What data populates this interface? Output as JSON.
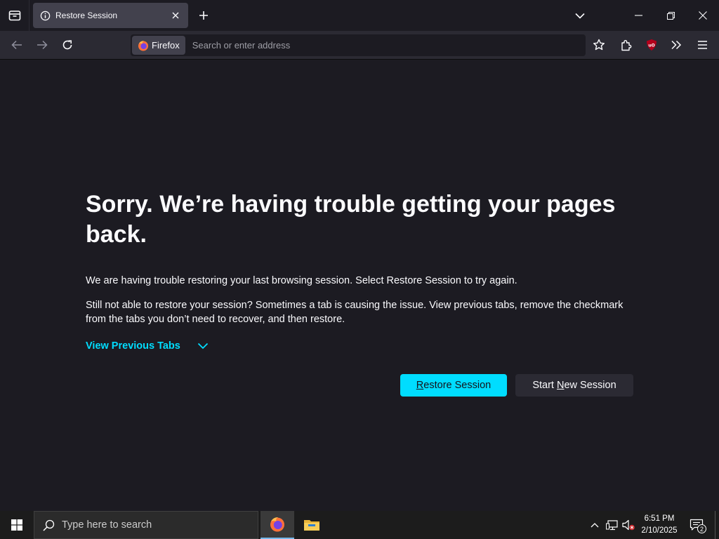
{
  "tab": {
    "title": "Restore Session",
    "icons": {
      "list": "tab-list-icon",
      "info": "info-icon",
      "close": "close-icon",
      "new": "plus-icon",
      "chevron": "chevron-down-icon"
    }
  },
  "window_controls": [
    "minimize-icon",
    "restore-icon",
    "close-icon"
  ],
  "navbar": {
    "identity_label": "Firefox",
    "url_placeholder": "Search or enter address",
    "icons": [
      "back-arrow-icon",
      "forward-arrow-icon",
      "reload-icon",
      "bookmark-star-icon",
      "extensions-icon",
      "ublock-origin-icon",
      "overflow-chevrons-icon",
      "hamburger-menu-icon"
    ]
  },
  "page": {
    "headline": "Sorry. We’re having trouble getting your pages back.",
    "paragraph1": "We are having trouble restoring your last browsing session. Select Restore Session to try again.",
    "paragraph2": "Still not able to restore your session? Sometimes a tab is causing the issue. View previous tabs, remove the checkmark from the tabs you don’t need to recover, and then restore.",
    "view_tabs_label": "View Previous Tabs",
    "restore_button": {
      "accesskey": "R",
      "rest": "estore Session"
    },
    "new_session_button": {
      "before": "Start ",
      "accesskey": "N",
      "after": "ew Session"
    }
  },
  "taskbar": {
    "search_placeholder": "Type here to search",
    "apps": [
      "firefox-icon",
      "file-explorer-icon"
    ],
    "time": "6:51 PM",
    "date": "2/10/2025",
    "notification_count": "2"
  },
  "colors": {
    "background": "#1c1b22",
    "toolbar": "#2b2a33",
    "accent": "#00ddff",
    "text": "#fbfbfe"
  }
}
